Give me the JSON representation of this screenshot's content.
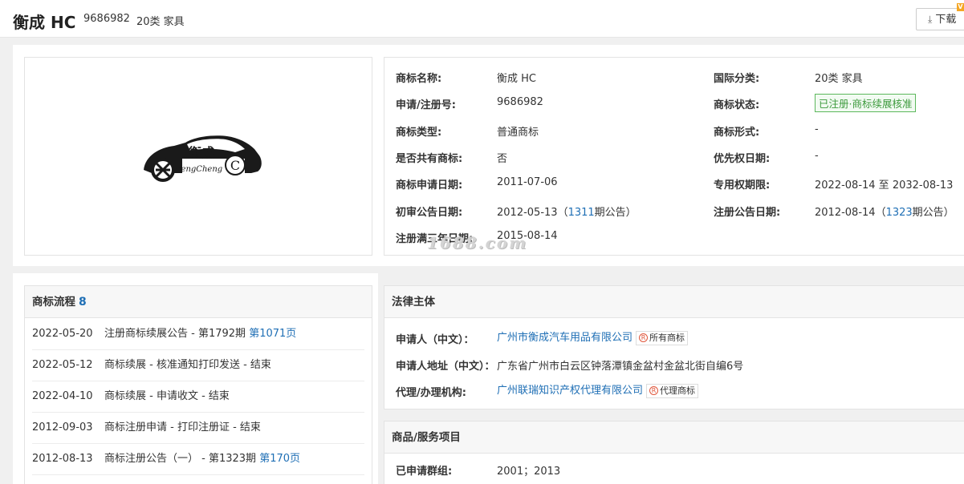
{
  "header": {
    "title": "衡成 HC",
    "reg_no": "9686982",
    "class": "20类 家具",
    "download_label": "下载",
    "vip_badge": "V"
  },
  "logo": {
    "chinese": "衡成",
    "pinyin": "HengCheng",
    "copyright": "C"
  },
  "info": {
    "left": [
      {
        "k": "商标名称:",
        "v": "衡成 HC"
      },
      {
        "k": "申请/注册号:",
        "v": "9686982"
      },
      {
        "k": "商标类型:",
        "v": "普通商标"
      },
      {
        "k": "是否共有商标:",
        "v": "否"
      },
      {
        "k": "商标申请日期:",
        "v": "2011-07-06"
      },
      {
        "k": "初审公告日期:",
        "v": "2012-05-13",
        "issue_pre": "（",
        "issue_no": "1311",
        "issue_suf": "期公告）"
      },
      {
        "k": "注册满三年日期:",
        "v": "2015-08-14"
      }
    ],
    "right": [
      {
        "k": "国际分类:",
        "v": "20类 家具"
      },
      {
        "k": "商标状态:",
        "v": "已注册·商标续展核准"
      },
      {
        "k": "商标形式:",
        "v": "-"
      },
      {
        "k": "优先权日期:",
        "v": "-"
      },
      {
        "k": "专用权期限:",
        "v": "2022-08-14 至 2032-08-13"
      },
      {
        "k": "注册公告日期:",
        "v": "2012-08-14",
        "issue_pre": "（",
        "issue_no": "1323",
        "issue_suf": "期公告）"
      }
    ],
    "status_color": "#3c9a3c"
  },
  "watermark": "1688.com",
  "flow": {
    "title": "商标流程",
    "count": "8",
    "rows": [
      {
        "date": "2022-05-20",
        "text": "注册商标续展公告 - 第1792期 ",
        "link": "第1071页"
      },
      {
        "date": "2022-05-12",
        "text": "商标续展 - 核准通知打印发送 - 结束",
        "link": ""
      },
      {
        "date": "2022-04-10",
        "text": "商标续展 - 申请收文 - 结束",
        "link": ""
      },
      {
        "date": "2012-09-03",
        "text": "商标注册申请 - 打印注册证 - 结束",
        "link": ""
      },
      {
        "date": "2012-08-13",
        "text": "商标注册公告（一） - 第1323期 ",
        "link": "第170页"
      }
    ]
  },
  "legal": {
    "title": "法律主体",
    "applicant_k": "申请人（中文）：",
    "applicant_v": "广州市衡成汽车用品有限公司",
    "applicant_tag": "所有商标",
    "address_k": "申请人地址（中文）：",
    "address_v": "广东省广州市白云区钟落潭镇金盆村金盆北街自编6号",
    "agent_k": "代理/办理机构:",
    "agent_v": "广州联瑞知识产权代理有限公司",
    "agent_tag": "代理商标",
    "tag_icon": "R"
  },
  "goods": {
    "title": "商品/服务项目",
    "group_k": "已申请群组:",
    "group_v": "2001；2013"
  },
  "colors": {
    "link": "#1f6fb5",
    "border": "#e3e3e3"
  }
}
